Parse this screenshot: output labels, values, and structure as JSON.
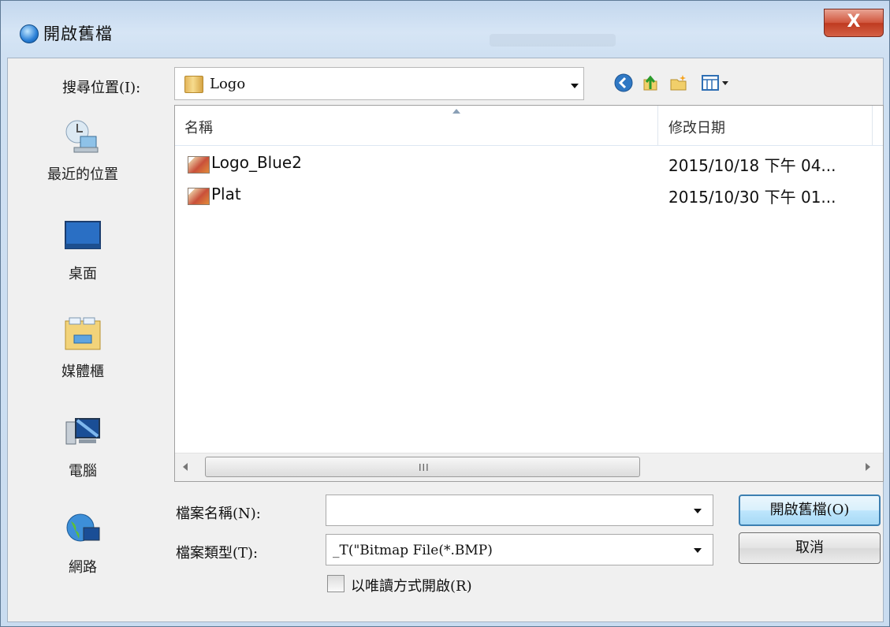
{
  "window": {
    "title": "開啟舊檔",
    "close_label": "X"
  },
  "look_in": {
    "label": "搜尋位置(I):",
    "value": "Logo"
  },
  "places": [
    {
      "label": "最近的位置",
      "icon": "recent-places-icon"
    },
    {
      "label": "桌面",
      "icon": "desktop-icon"
    },
    {
      "label": "媒體櫃",
      "icon": "libraries-icon"
    },
    {
      "label": "電腦",
      "icon": "computer-icon"
    },
    {
      "label": "網路",
      "icon": "network-icon"
    }
  ],
  "toolbar": {
    "icons": [
      "back-icon",
      "up-folder-icon",
      "new-folder-icon",
      "view-menu-icon"
    ]
  },
  "file_list": {
    "columns": [
      "名稱",
      "修改日期"
    ],
    "files": [
      {
        "name": "Logo_Blue2",
        "modified": "2015/10/18 下午 04..."
      },
      {
        "name": "Plat",
        "modified": "2015/10/30 下午 01..."
      }
    ],
    "scroll_grip": "III"
  },
  "filename": {
    "label": "檔案名稱(N):",
    "value": ""
  },
  "filetype": {
    "label": "檔案類型(T):",
    "value": "_T(\"Bitmap File(*.BMP)"
  },
  "readonly": {
    "label": "以唯讀方式開啟(R)",
    "checked": false
  },
  "buttons": {
    "open": "開啟舊檔(O)",
    "cancel": "取消"
  },
  "colors": {
    "accent": "#3c7fb1",
    "title_bg": "#c9dcf0",
    "close_red": "#c8452a"
  }
}
